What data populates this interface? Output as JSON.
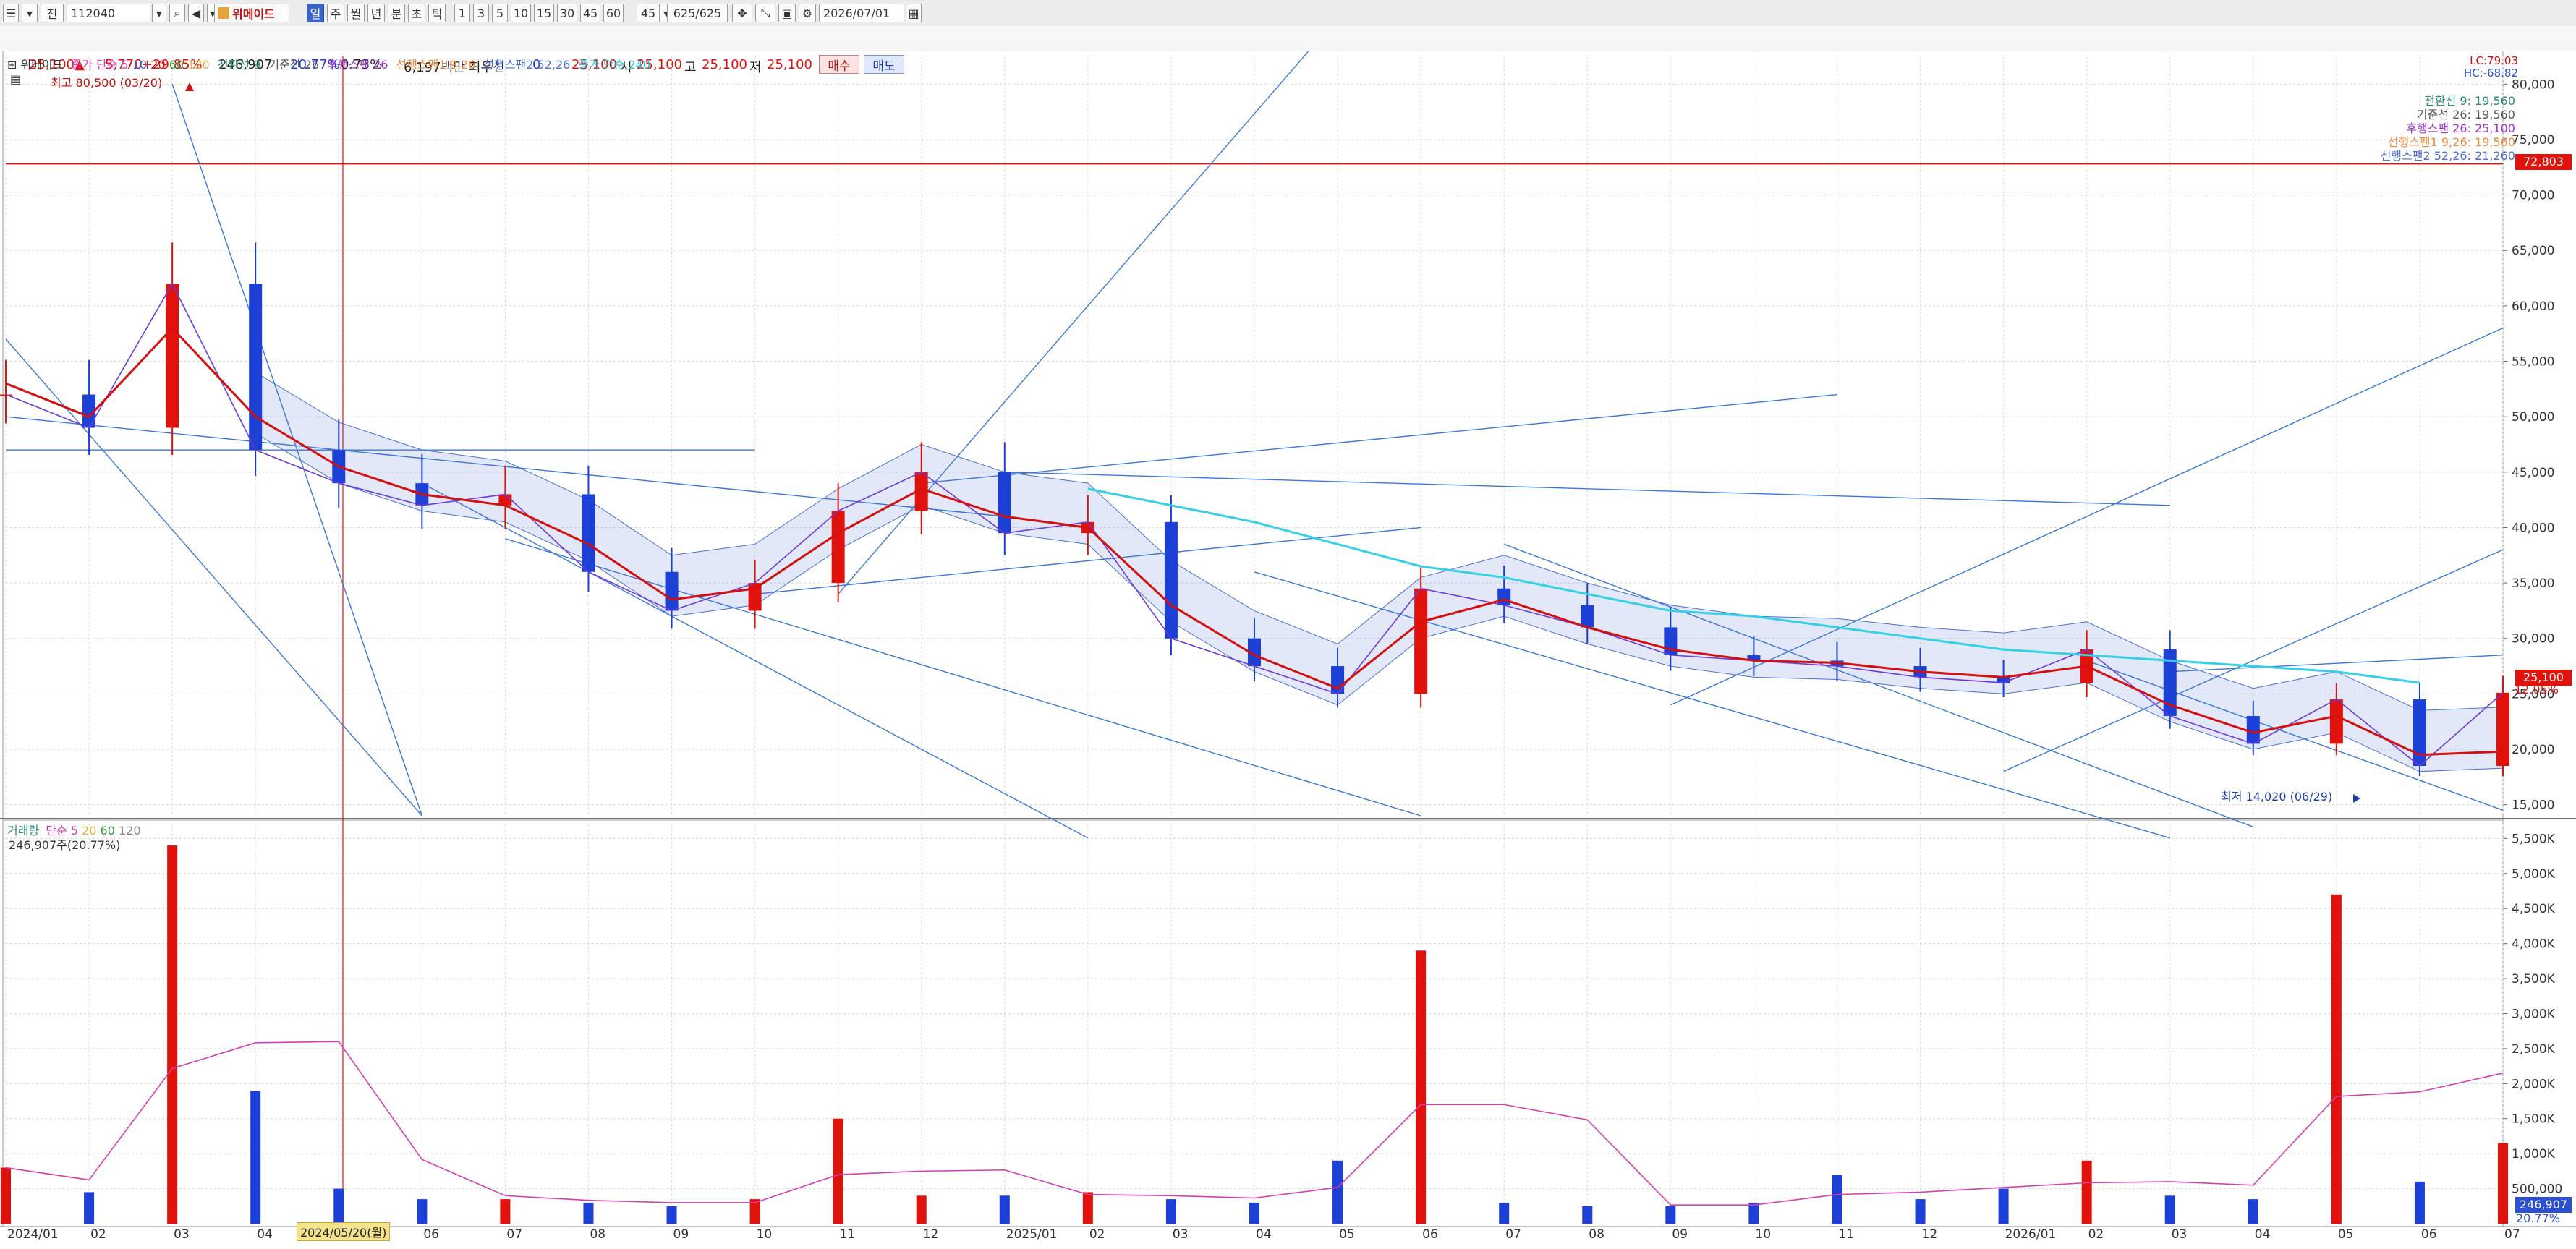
{
  "toolbar": {
    "scope": "전",
    "code": "112040",
    "name": "위메이드",
    "periods": [
      "일",
      "주",
      "월",
      "년",
      "분",
      "초",
      "틱"
    ],
    "active_period": "일",
    "intervals": [
      "1",
      "3",
      "5",
      "10",
      "15",
      "30",
      "45",
      "60"
    ],
    "interval_select": "45",
    "count": "625/625",
    "date": "2026/07/01"
  },
  "quote": {
    "price": "25,100",
    "change": "5,770",
    "change_pct": "+29.85%",
    "volume": "246,907",
    "vol_ratio": "20.77%",
    "turnover": "0.73%",
    "amount": "6,197백만",
    "pref_label": "최우선",
    "pref_value": "0",
    "bid": "25,100",
    "open_label": "시",
    "open": "25,100",
    "high_label": "고",
    "high": "25,100",
    "low_label": "저",
    "low": "25,100",
    "buy_label": "매수",
    "sell_label": "매도"
  },
  "price_legend": {
    "title": "위메이드",
    "ma_label": "종가 단순",
    "ma_periods": [
      "5",
      "10",
      "20",
      "60",
      "120"
    ],
    "ichimoku": [
      "전환선 9",
      "기준선 26",
      "후행스팬 26",
      "선행스팬1 9,26",
      "선행스팬2 52,26"
    ],
    "ma240": "종가 단순 240"
  },
  "price_panel": {
    "high_marker": "최고 80,500 (03/20)",
    "low_marker": "최저 14,020 (06/29)",
    "lc": "LC:79.03",
    "hc": "HC:-68.82",
    "ichimoku_values": [
      "전환선 9: 19,560",
      "기준선 26: 19,560",
      "후행스팬 26: 25,100",
      "선행스팬1 9,26: 19,560",
      "선행스팬2 52,26: 21,260"
    ],
    "hline_label": "72,803",
    "price_tag": "25,100",
    "pct_tag": "12.05%",
    "cursor_date": "2024/05/20(월)"
  },
  "volume_legend": {
    "title": "거래량",
    "ma_label": "단순",
    "ma_periods": [
      "5",
      "20",
      "60",
      "120"
    ],
    "current": "246,907주(20.77%)"
  },
  "volume_panel": {
    "tag1": "246,907",
    "tag2": "20.77%"
  },
  "colors": {
    "up": "#e0120b",
    "down": "#1c3fd6",
    "ma5": "#d43fb0",
    "ma10": "#3a63d8",
    "ma20": "#d40f0f",
    "ma60": "#2b9b3b",
    "ma120": "#e8b23a",
    "kumo_blue": "#4a6fd3",
    "kumo_orange": "#f0883a",
    "ma240": "#35d0e6",
    "trend": "#3a78d4"
  },
  "chart_data": [
    {
      "type": "line",
      "title": "위메이드",
      "y_axis_ticks": [
        "80,000",
        "75,000",
        "70,000",
        "65,000",
        "60,000",
        "55,000",
        "50,000",
        "45,000",
        "40,000",
        "35,000",
        "30,000",
        "25,000",
        "20,000",
        "15,000"
      ],
      "x_axis_ticks": [
        "2024/01",
        "02",
        "03",
        "04",
        "05",
        "06",
        "07",
        "08",
        "09",
        "10",
        "11",
        "12",
        "2025/01",
        "02",
        "03",
        "04",
        "05",
        "06",
        "07",
        "08",
        "09",
        "10",
        "11",
        "12",
        "2026/01",
        "02",
        "03",
        "04",
        "05",
        "06",
        "07"
      ],
      "ylim": [
        14000,
        82500
      ],
      "x": [
        "2024-01",
        "2024-02",
        "2024-03",
        "2024-04",
        "2024-05",
        "2024-06",
        "2024-07",
        "2024-08",
        "2024-09",
        "2024-10",
        "2024-11",
        "2024-12",
        "2025-01",
        "2025-02",
        "2025-03",
        "2025-04",
        "2025-05",
        "2025-06",
        "2025-07",
        "2025-08",
        "2025-09",
        "2025-10",
        "2025-11",
        "2025-12",
        "2026-01",
        "2026-02",
        "2026-03",
        "2026-04",
        "2026-05",
        "2026-06",
        "2026-07"
      ],
      "series": [
        {
          "name": "종가",
          "values": [
            52000,
            49000,
            62000,
            47000,
            44000,
            42000,
            43000,
            36000,
            32500,
            35000,
            41500,
            45000,
            39500,
            40500,
            30000,
            27500,
            25000,
            34500,
            33000,
            31000,
            28500,
            28000,
            27500,
            26500,
            26000,
            29000,
            23000,
            20500,
            24500,
            18500,
            25100
          ]
        },
        {
          "name": "20",
          "values": [
            53000,
            50000,
            58000,
            50000,
            45500,
            43000,
            42000,
            38500,
            33500,
            34500,
            39500,
            43500,
            41000,
            40000,
            33000,
            28500,
            25500,
            31500,
            33500,
            31000,
            29000,
            28000,
            27800,
            27000,
            26500,
            27500,
            24000,
            21500,
            23000,
            19500,
            19800
          ]
        },
        {
          "name": "종가 단순 240",
          "values": [
            null,
            null,
            null,
            null,
            null,
            null,
            null,
            null,
            null,
            null,
            null,
            null,
            null,
            43500,
            42000,
            40500,
            38500,
            36500,
            35500,
            34000,
            32500,
            32000,
            31000,
            30000,
            29000,
            28500,
            28000,
            27500,
            27000,
            26000,
            null
          ]
        }
      ]
    },
    {
      "type": "bar",
      "title": "거래량",
      "y_axis_ticks": [
        "5,500K",
        "5,000K",
        "4,500K",
        "4,000K",
        "3,500K",
        "3,000K",
        "2,500K",
        "2,000K",
        "1,500K",
        "1,000K",
        "500,000"
      ],
      "ylim": [
        0,
        5700000
      ],
      "categories": [
        "2024-01",
        "2024-02",
        "2024-03",
        "2024-04",
        "2024-05",
        "2024-06",
        "2024-07",
        "2024-08",
        "2024-09",
        "2024-10",
        "2024-11",
        "2024-12",
        "2025-01",
        "2025-02",
        "2025-03",
        "2025-04",
        "2025-05",
        "2025-06",
        "2025-07",
        "2025-08",
        "2025-09",
        "2025-10",
        "2025-11",
        "2025-12",
        "2026-01",
        "2026-02",
        "2026-03",
        "2026-04",
        "2026-05",
        "2026-06",
        "2026-07"
      ],
      "values": [
        800000,
        450000,
        5400000,
        1900000,
        500000,
        350000,
        350000,
        300000,
        250000,
        350000,
        1500000,
        400000,
        400000,
        450000,
        350000,
        300000,
        900000,
        3900000,
        300000,
        250000,
        250000,
        300000,
        700000,
        350000,
        500000,
        900000,
        400000,
        350000,
        4700000,
        600000,
        1150000
      ]
    }
  ]
}
